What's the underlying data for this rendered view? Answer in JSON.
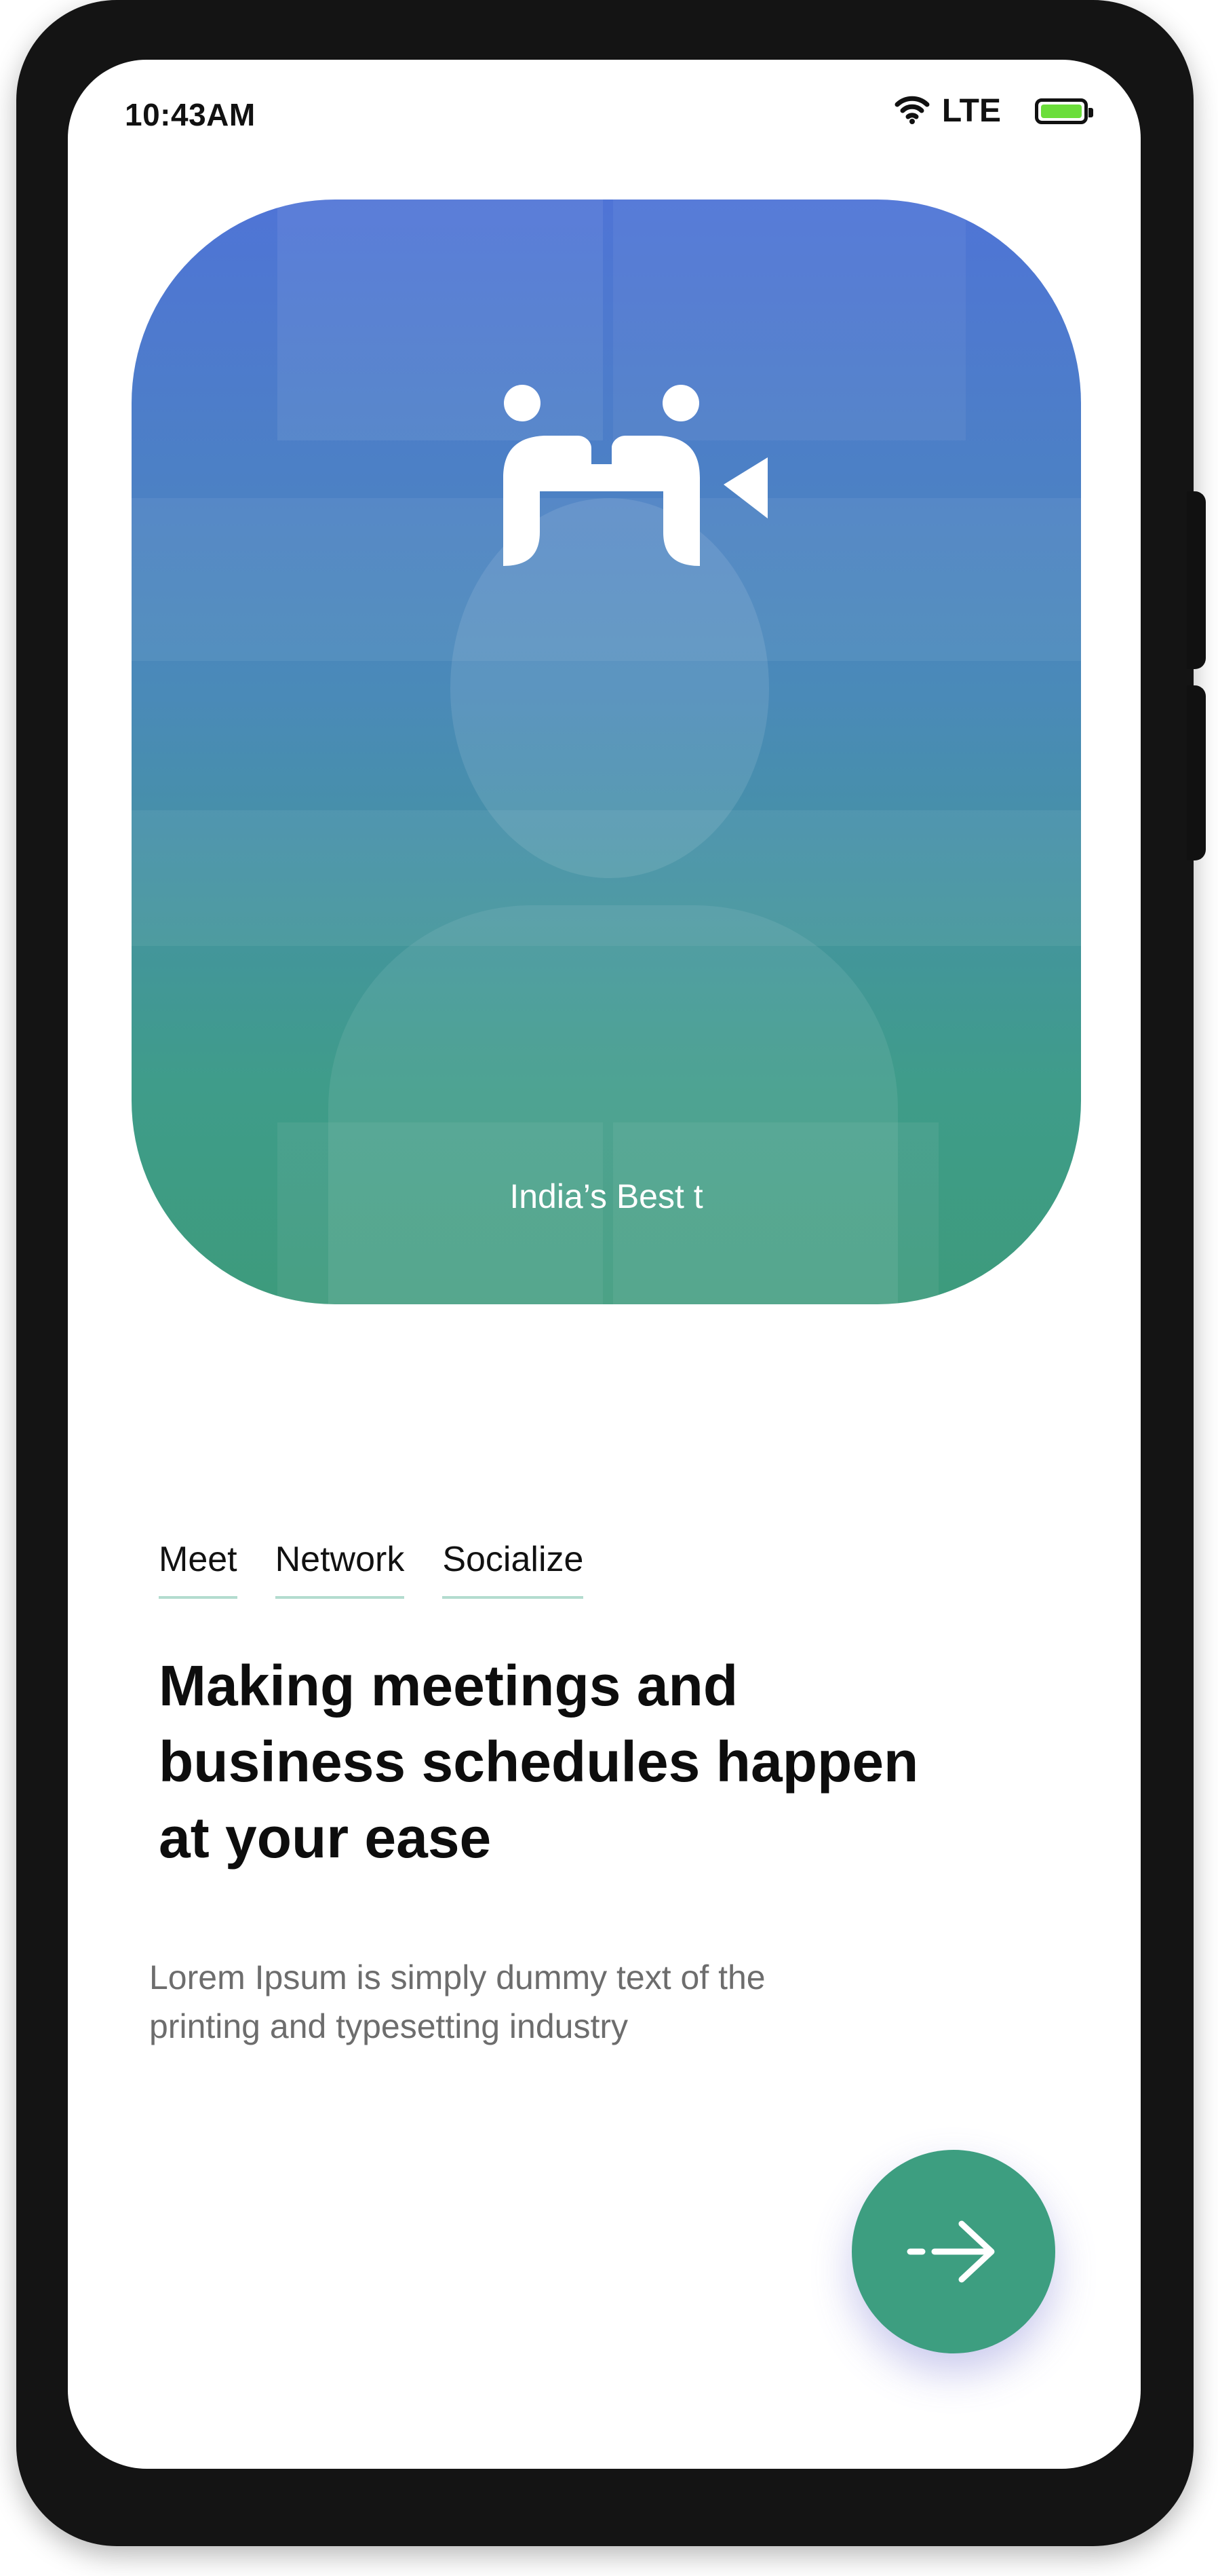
{
  "status_bar": {
    "time": "10:43AM",
    "network": "LTE",
    "icons": [
      "wifi-icon",
      "battery-icon"
    ],
    "battery_color": "#6bde3a"
  },
  "hero": {
    "caption": "India’s Best t",
    "logo_icon": "meeting-logo-icon",
    "gradient": [
      "#4f74d6",
      "#3d9b7c"
    ]
  },
  "tabs": [
    {
      "label": "Meet"
    },
    {
      "label": "Network"
    },
    {
      "label": "Socialize"
    }
  ],
  "headline": {
    "line1": "Making meetings and",
    "line2": "business schedules happen",
    "line3": "at your ease"
  },
  "body": {
    "line1": "Lorem Ipsum is simply dummy text of the",
    "line2": "printing and typesetting industry"
  },
  "next_button": {
    "icon": "arrow-right-icon",
    "color": "#3d9e80"
  }
}
